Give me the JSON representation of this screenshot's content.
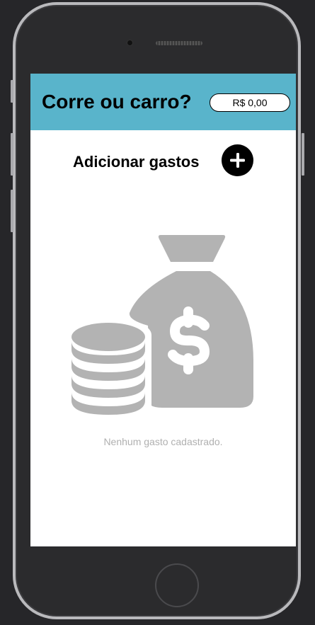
{
  "app": {
    "title": "Corre ou carro?",
    "balance": "R$ 0,00"
  },
  "actions": {
    "add_label": "Adicionar gastos",
    "add_icon": "plus-icon"
  },
  "empty_state": {
    "icon": "money-bag-coins-icon",
    "message": "Nenhum gasto cadastrado."
  },
  "colors": {
    "header_bg": "#59b4cb",
    "illustration": "#b3b3b3",
    "empty_text": "#b0b0b0"
  }
}
